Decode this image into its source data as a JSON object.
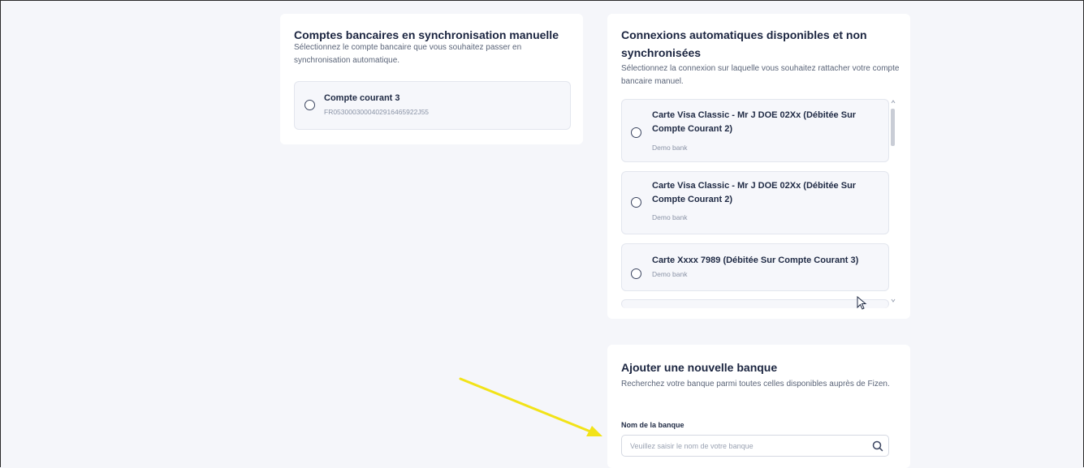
{
  "manual_panel": {
    "title": "Comptes bancaires en synchronisation manuelle",
    "description": "Sélectionnez le compte bancaire que vous souhaitez passer en synchronisation automatique.",
    "accounts": [
      {
        "name": "Compte courant 3",
        "iban": "FR0530003000402916465922J55"
      }
    ]
  },
  "auto_panel": {
    "title": "Connexions automatiques disponibles et non synchronisées",
    "description": "Sélectionnez la connexion sur laquelle vous souhaitez rattacher votre compte bancaire manuel.",
    "connections": [
      {
        "name": "Carte Visa Classic - Mr J DOE 02Xx (Débitée Sur Compte Courant 2)",
        "bank": "Demo bank"
      },
      {
        "name": "Carte Visa Classic - Mr J DOE 02Xx (Débitée Sur Compte Courant 2)",
        "bank": "Demo bank"
      },
      {
        "name": "Carte Xxxx 7989 (Débitée Sur Compte Courant 3)",
        "bank": "Demo bank"
      }
    ]
  },
  "add_bank_panel": {
    "title": "Ajouter une nouvelle banque",
    "description": "Recherchez votre banque parmi toutes celles disponibles auprès de Fizen.",
    "field_label": "Nom de la banque",
    "placeholder": "Veuillez saisir le nom de votre banque",
    "value": ""
  },
  "colors": {
    "background": "#f5f6fa",
    "card": "#ffffff",
    "heading": "#1b2540",
    "annotation_arrow": "#f2e318"
  },
  "icons": [
    "radio-button-icon",
    "search-icon",
    "mouse-cursor-icon",
    "annotation-arrow-icon"
  ]
}
